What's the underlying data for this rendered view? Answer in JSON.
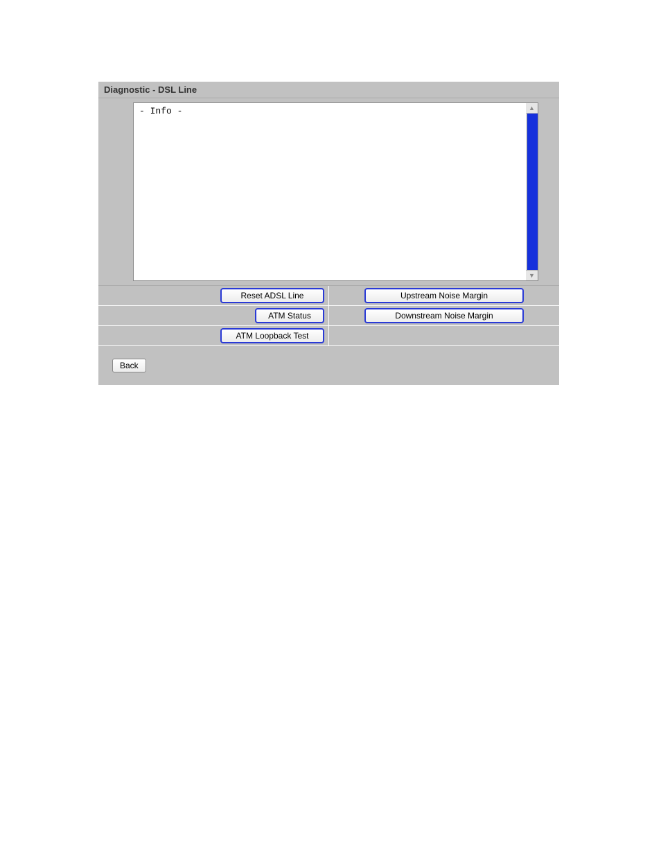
{
  "title": "Diagnostic - DSL Line",
  "info_text": "- Info -",
  "buttons": {
    "reset_adsl": "Reset ADSL Line",
    "upstream_noise": "Upstream Noise Margin",
    "atm_status": "ATM Status",
    "downstream_noise": "Downstream Noise Margin",
    "atm_loopback": "ATM Loopback Test",
    "back": "Back"
  }
}
